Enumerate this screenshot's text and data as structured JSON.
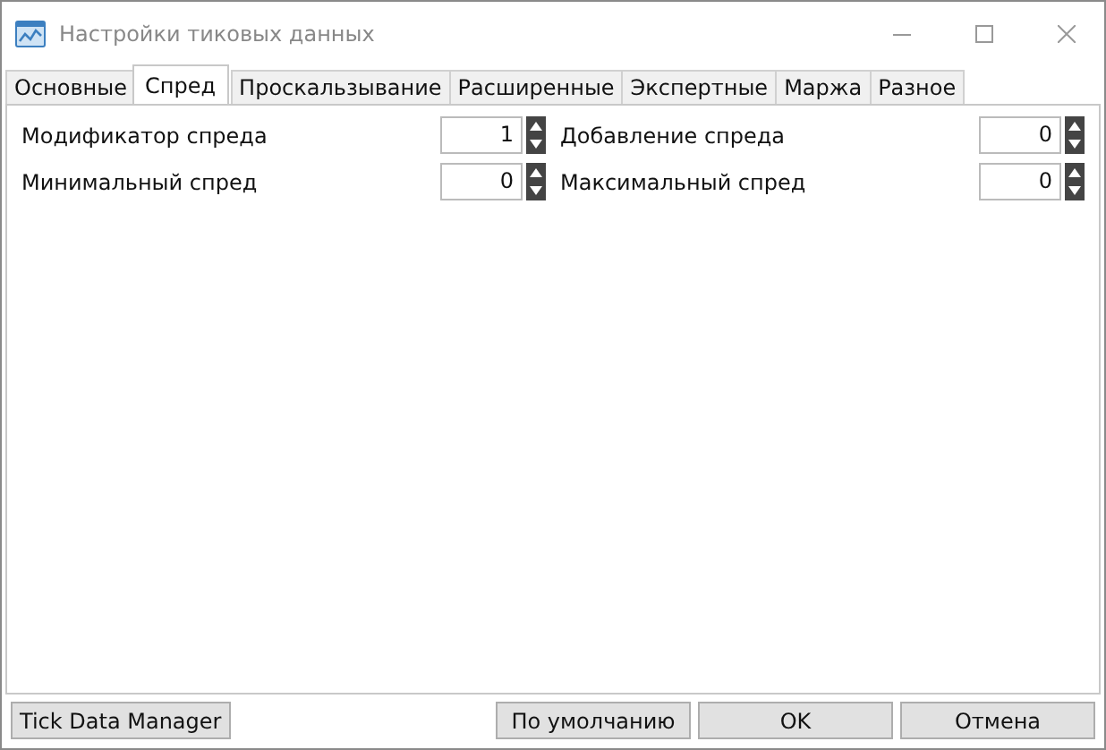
{
  "window": {
    "title": "Настройки тиковых данных"
  },
  "tabs": [
    {
      "label": "Основные",
      "selected": false
    },
    {
      "label": "Спред",
      "selected": true
    },
    {
      "label": "Проскальзывание",
      "selected": false
    },
    {
      "label": "Расширенные",
      "selected": false
    },
    {
      "label": "Экспертные",
      "selected": false
    },
    {
      "label": "Маржа",
      "selected": false
    },
    {
      "label": "Разное",
      "selected": false
    }
  ],
  "fields": [
    {
      "label": "Модификатор спреда",
      "value": "1"
    },
    {
      "label": "Добавление спреда",
      "value": "0"
    },
    {
      "label": "Минимальный спред",
      "value": "0"
    },
    {
      "label": "Максимальный спред",
      "value": "0"
    }
  ],
  "footer": {
    "left_button": "Tick Data Manager",
    "buttons": [
      "По умолчанию",
      "OK",
      "Отмена"
    ]
  }
}
